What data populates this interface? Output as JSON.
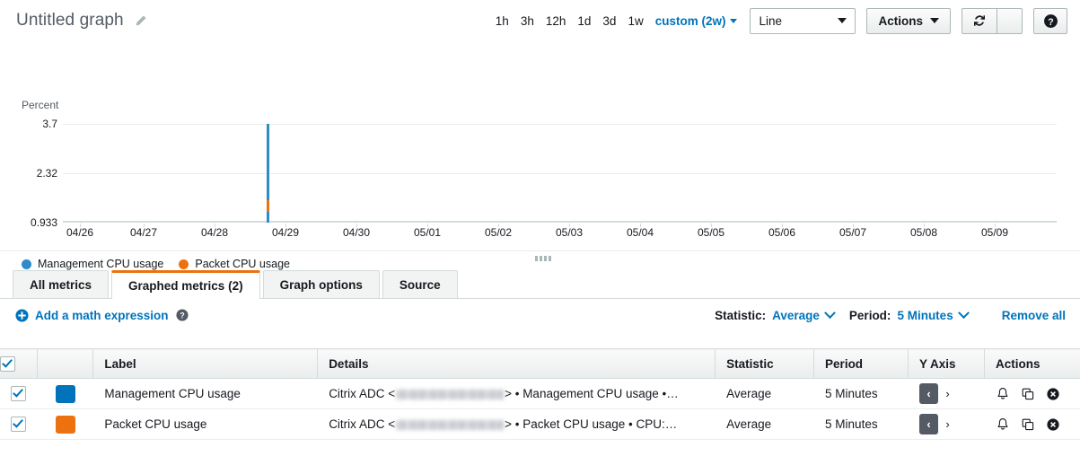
{
  "header": {
    "title": "Untitled graph",
    "edit_icon": "pencil-icon",
    "ranges": [
      {
        "label": "1h",
        "active": false
      },
      {
        "label": "3h",
        "active": false
      },
      {
        "label": "12h",
        "active": false
      },
      {
        "label": "1d",
        "active": false
      },
      {
        "label": "3d",
        "active": false
      },
      {
        "label": "1w",
        "active": false
      }
    ],
    "custom_range": "custom (2w)",
    "graph_type": "Line",
    "actions_label": "Actions",
    "refresh_icon": "refresh-icon",
    "refresh_caret_icon": "chevron-down-icon",
    "help_icon": "help-icon"
  },
  "chart_data": {
    "type": "line",
    "title": "Untitled graph",
    "ylabel": "Percent",
    "xlabel": "",
    "yticks": [
      3.7,
      2.32,
      0.933
    ],
    "ylim": [
      0.933,
      3.7
    ],
    "grid": true,
    "legend_position": "bottom-left",
    "categories": [
      "04/26",
      "04/27",
      "04/28",
      "04/29",
      "04/30",
      "05/01",
      "05/02",
      "05/03",
      "05/04",
      "05/05",
      "05/06",
      "05/07",
      "05/08",
      "05/09"
    ],
    "series": [
      {
        "name": "Management CPU usage",
        "color": "#2e8bc7",
        "x": [
          "04/28 12:00"
        ],
        "values": [
          3.7
        ],
        "baseline": 0.933
      },
      {
        "name": "Packet CPU usage",
        "color": "#ec7211",
        "x": [
          "04/28 12:00"
        ],
        "values": [
          1.45
        ],
        "baseline": 1.3
      }
    ],
    "legend": [
      "Management CPU usage",
      "Packet CPU usage"
    ]
  },
  "tabs": [
    {
      "label": "All metrics",
      "active": false
    },
    {
      "label": "Graphed metrics (2)",
      "active": true
    },
    {
      "label": "Graph options",
      "active": false
    },
    {
      "label": "Source",
      "active": false
    }
  ],
  "toolbar": {
    "add_math_expression": "Add a math expression",
    "add_icon": "plus-circle-icon",
    "help_icon": "help-icon",
    "statistic_label": "Statistic:",
    "statistic_value": "Average",
    "period_label": "Period:",
    "period_value": "5 Minutes",
    "remove_all": "Remove all"
  },
  "table": {
    "columns": [
      "",
      "",
      "Label",
      "Details",
      "Statistic",
      "Period",
      "Y Axis",
      "Actions"
    ],
    "header_checkbox_checked": true,
    "rows": [
      {
        "checked": true,
        "color": "#0073bb",
        "label": "Management CPU usage",
        "details_prefix": "Citrix ADC <",
        "details_suffix": "> • Management CPU usage •…",
        "statistic": "Average",
        "period": "5 Minutes",
        "y_axis_left": "‹",
        "y_axis_right": "›",
        "y_axis_selected": "left",
        "actions": [
          "alarm-bell-icon",
          "duplicate-icon",
          "remove-icon"
        ]
      },
      {
        "checked": true,
        "color": "#ec7211",
        "label": "Packet CPU usage",
        "details_prefix": "Citrix ADC <",
        "details_suffix": "> • Packet CPU usage • CPU:…",
        "statistic": "Average",
        "period": "5 Minutes",
        "y_axis_left": "‹",
        "y_axis_right": "›",
        "y_axis_selected": "left",
        "actions": [
          "alarm-bell-icon",
          "duplicate-icon",
          "remove-icon"
        ]
      }
    ]
  }
}
